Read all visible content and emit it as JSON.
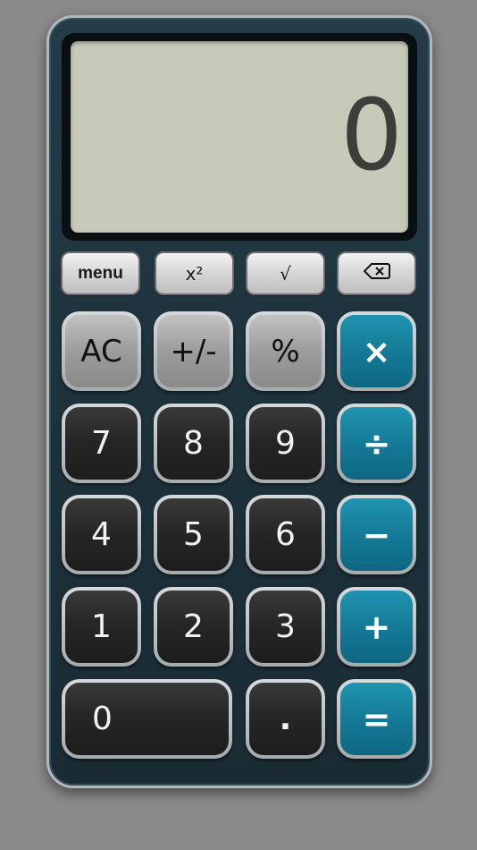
{
  "display": {
    "value": "0"
  },
  "top_row": {
    "menu_label": "menu",
    "square_label": "x²",
    "sqrt_label": "√",
    "backspace_label": "⌫"
  },
  "keys": {
    "ac": "AC",
    "plus_minus": "+/-",
    "percent": "%",
    "multiply": "×",
    "divide": "÷",
    "minus": "−",
    "plus": "+",
    "equals": "=",
    "d7": "7",
    "d8": "8",
    "d9": "9",
    "d4": "4",
    "d5": "5",
    "d6": "6",
    "d1": "1",
    "d2": "2",
    "d3": "3",
    "d0": "0",
    "decimal": "."
  },
  "colors": {
    "background": "#8a8a8a",
    "body": "#243c48",
    "display": "#c7cab8",
    "operator": "#137895",
    "digit": "#262626",
    "function": "#9c9c9c"
  }
}
